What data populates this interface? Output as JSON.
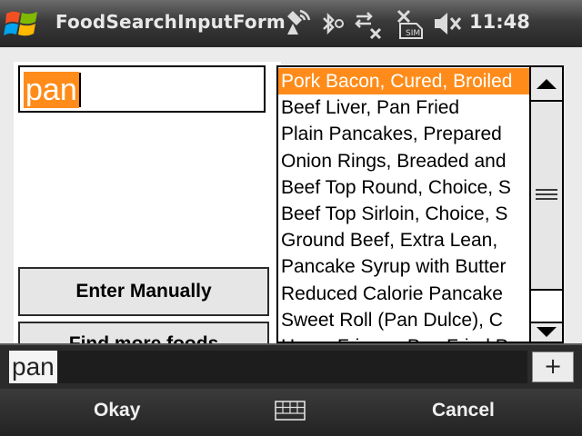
{
  "titlebar": {
    "app_title": "FoodSearchInputForm",
    "clock": "11:48",
    "icons": [
      "windows-start-icon",
      "data-connection-icon",
      "bluetooth-icon",
      "sync-off-icon",
      "no-sim-icon",
      "volume-off-icon"
    ]
  },
  "form": {
    "search_value": "pan",
    "enter_manually_label": "Enter Manually",
    "find_more_label": "Find more foods"
  },
  "results": {
    "selected_index": 0,
    "items": [
      "Pork Bacon, Cured, Broiled",
      "Beef Liver, Pan Fried",
      "Plain Pancakes, Prepared",
      "Onion Rings, Breaded and",
      "Beef Top Round, Choice, S",
      "Beef Top Sirloin, Choice, S",
      "Ground Beef, Extra Lean,",
      "Pancake Syrup with Butter",
      "Reduced Calorie Pancake",
      "Sweet Roll (Pan Dulce), C",
      "Home Fries or Pan Fried P"
    ]
  },
  "input_bar": {
    "value": "pan",
    "plus_label": "+"
  },
  "softkeys": {
    "left": "Okay",
    "right": "Cancel",
    "center_icon": "keyboard-icon"
  },
  "colors": {
    "accent": "#ff8c1a",
    "titlebar": "#3a3a3a",
    "softkey_bar": "#2b2b2b"
  }
}
